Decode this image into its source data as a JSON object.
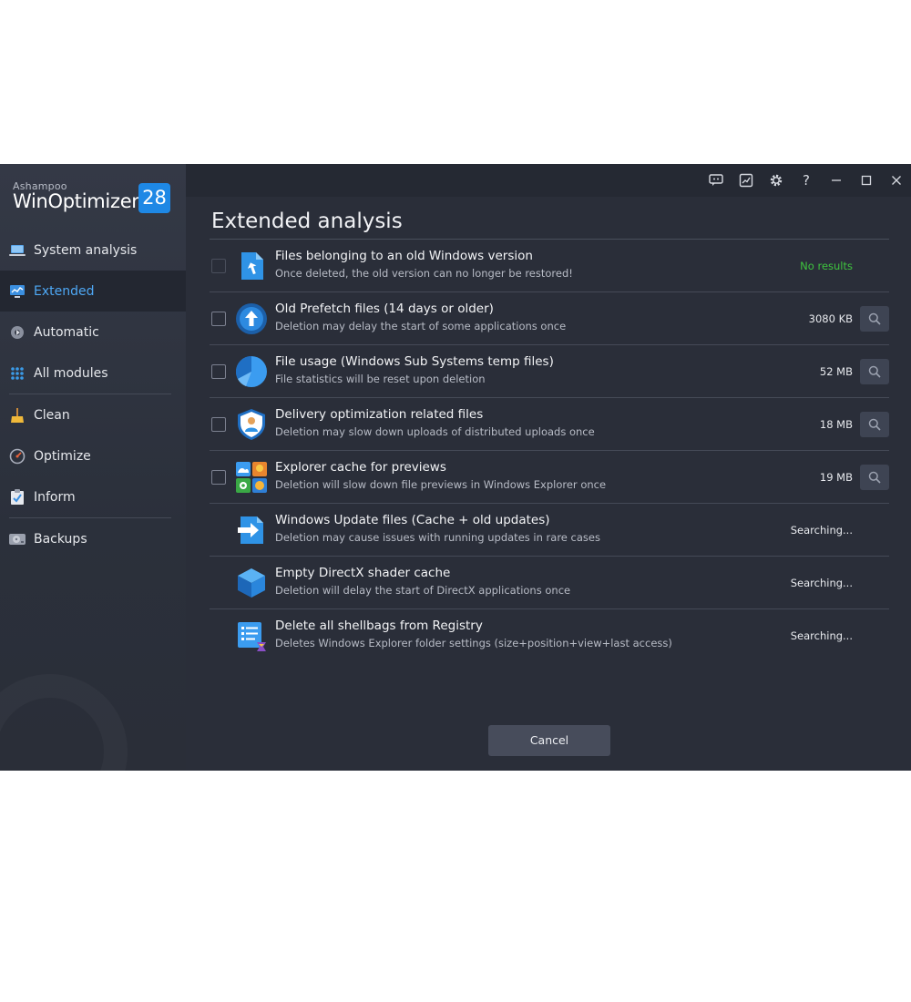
{
  "brand": {
    "vendor": "Ashampoo",
    "product": "WinOptimizer",
    "version": "28"
  },
  "sidebar": {
    "items": [
      {
        "label": "System analysis",
        "icon": "laptop-icon",
        "active": false
      },
      {
        "label": "Extended",
        "icon": "monitor-chart-icon",
        "active": true
      },
      {
        "label": "Automatic",
        "icon": "auto-gear-icon",
        "active": false
      },
      {
        "label": "All modules",
        "icon": "grid-dots-icon",
        "active": false
      },
      {
        "label": "Clean",
        "icon": "broom-icon",
        "active": false
      },
      {
        "label": "Optimize",
        "icon": "speedometer-icon",
        "active": false
      },
      {
        "label": "Inform",
        "icon": "clipboard-check-icon",
        "active": false
      },
      {
        "label": "Backups",
        "icon": "hard-drive-icon",
        "active": false
      }
    ]
  },
  "titlebar": {
    "icons": [
      "feedback-icon",
      "chart-window-icon",
      "gear-icon",
      "help-icon",
      "minimize-icon",
      "maximize-icon",
      "close-icon"
    ],
    "help_glyph": "?"
  },
  "main": {
    "title": "Extended analysis",
    "rows": [
      {
        "title": "Files belonging to an old Windows version",
        "desc": "Once deleted, the old version can no longer be restored!",
        "status": "No results",
        "status_type": "ok",
        "checkbox": "disabled",
        "scan": false,
        "icon": "old-windows-file-icon"
      },
      {
        "title": "Old Prefetch files (14 days or older)",
        "desc": "Deletion may delay the start of some applications once",
        "status": "3080 KB",
        "status_type": "size",
        "checkbox": "unchecked",
        "scan": true,
        "icon": "prefetch-upload-icon"
      },
      {
        "title": "File usage (Windows Sub Systems temp files)",
        "desc": "File statistics will be reset upon deletion",
        "status": "52 MB",
        "status_type": "size",
        "checkbox": "unchecked",
        "scan": true,
        "icon": "pie-chart-icon"
      },
      {
        "title": "Delivery optimization related files",
        "desc": "Deletion may slow down uploads of distributed uploads once",
        "status": "18 MB",
        "status_type": "size",
        "checkbox": "unchecked",
        "scan": true,
        "icon": "shield-user-icon"
      },
      {
        "title": "Explorer cache for previews",
        "desc": "Deletion will slow down file previews in Windows Explorer once",
        "status": "19 MB",
        "status_type": "size",
        "checkbox": "unchecked",
        "scan": true,
        "icon": "preview-tiles-icon"
      },
      {
        "title": "Windows Update files (Cache + old updates)",
        "desc": "Deletion may cause issues with running updates in rare cases",
        "status": "Searching...",
        "status_type": "searching",
        "checkbox": "none",
        "scan": false,
        "icon": "update-arrow-icon"
      },
      {
        "title": "Empty DirectX shader cache",
        "desc": "Deletion will delay the start of DirectX applications once",
        "status": "Searching...",
        "status_type": "searching",
        "checkbox": "none",
        "scan": false,
        "icon": "directx-cube-icon"
      },
      {
        "title": "Delete all shellbags from Registry",
        "desc": "Deletes Windows Explorer folder settings (size+position+view+last access)",
        "status": "Searching...",
        "status_type": "searching",
        "checkbox": "none",
        "scan": false,
        "icon": "registry-list-icon"
      }
    ],
    "cancel_label": "Cancel"
  },
  "colors": {
    "accent": "#1e88e5",
    "active_text": "#4ea8f5",
    "ok": "#3ec43e",
    "bg": "#2a2e39",
    "sidebar": "#343946"
  }
}
